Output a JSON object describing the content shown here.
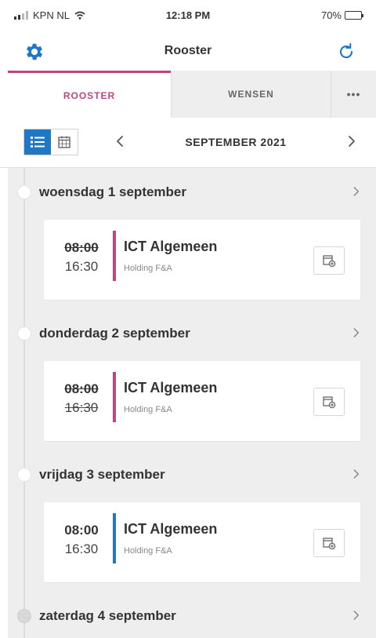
{
  "status": {
    "carrier": "KPN NL",
    "time": "12:18 PM",
    "battery": "70%",
    "battery_level": 0.7
  },
  "nav": {
    "title": "Rooster"
  },
  "tabs": [
    {
      "label": "ROOSTER",
      "active": true
    },
    {
      "label": "WENSEN",
      "active": false
    },
    {
      "label": "•••",
      "active": false
    }
  ],
  "toolbar": {
    "month": "SEPTEMBER 2021"
  },
  "colors": {
    "accent_pink": "#c2447f",
    "accent_blue": "#1f77c5"
  },
  "days": [
    {
      "label": "woensdag 1 september",
      "shifts": [
        {
          "start": "08:00",
          "end": "16:30",
          "title": "ICT Algemeen",
          "org": "Holding F&A"
        }
      ]
    },
    {
      "label": "donderdag 2 september",
      "shifts": [
        {
          "start": "08:00",
          "end": "16:30",
          "title": "ICT Algemeen",
          "org": "Holding F&A"
        }
      ]
    },
    {
      "label": "vrijdag 3 september",
      "shifts": [
        {
          "start": "08:00",
          "end": "16:30",
          "title": "ICT Algemeen",
          "org": "Holding F&A"
        }
      ]
    },
    {
      "label": "zaterdag 4 september",
      "shifts": []
    }
  ]
}
